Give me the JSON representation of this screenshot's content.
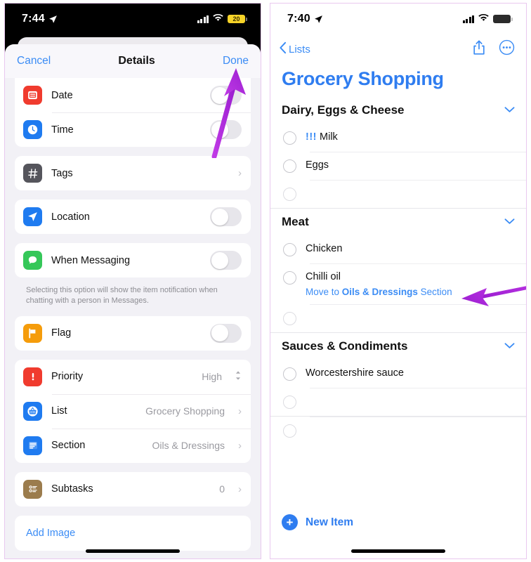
{
  "left_phone": {
    "status": {
      "time": "7:44",
      "location_icon": "location-arrow-icon",
      "signal": "cellular-bars-icon",
      "wifi": "wifi-icon",
      "battery_level": "20",
      "battery_mode": "low-power"
    },
    "sheet": {
      "cancel_label": "Cancel",
      "title": "Details",
      "done_label": "Done",
      "groups": [
        {
          "rows": [
            {
              "icon": "calendar-icon",
              "icon_color": "#f03b2e",
              "label": "Date",
              "control": "toggle",
              "toggle_on": false
            },
            {
              "icon": "clock-icon",
              "icon_color": "#1f7bf0",
              "label": "Time",
              "control": "toggle",
              "toggle_on": false
            }
          ]
        },
        {
          "rows": [
            {
              "icon": "hash-tag-icon",
              "icon_color": "#55555c",
              "label": "Tags",
              "control": "chevron",
              "chevron": "›"
            }
          ]
        },
        {
          "rows": [
            {
              "icon": "location-icon",
              "icon_color": "#1f7bf0",
              "label": "Location",
              "control": "toggle",
              "toggle_on": false
            }
          ]
        },
        {
          "rows": [
            {
              "icon": "messages-icon",
              "icon_color": "#35c759",
              "label": "When Messaging",
              "control": "toggle",
              "toggle_on": false
            }
          ],
          "footnote": "Selecting this option will show the item notification when chatting with a person in Messages."
        },
        {
          "rows": [
            {
              "icon": "flag-icon",
              "icon_color": "#f59c0b",
              "label": "Flag",
              "control": "toggle",
              "toggle_on": false
            }
          ]
        },
        {
          "rows": [
            {
              "icon": "priority-exclamation-icon",
              "icon_color": "#f03b2e",
              "label": "Priority",
              "value": "High",
              "control": "stepper",
              "stepper": "⌃⌄"
            },
            {
              "icon": "basket-icon",
              "icon_color": "#1f7bf0",
              "label": "List",
              "value": "Grocery Shopping",
              "control": "chevron",
              "chevron": "›"
            },
            {
              "icon": "section-lines-icon",
              "icon_color": "#1f7bf0",
              "label": "Section",
              "value": "Oils & Dressings",
              "control": "chevron",
              "chevron": "›"
            }
          ]
        },
        {
          "rows": [
            {
              "icon": "subtasks-icon",
              "icon_color": "#9b7c4d",
              "label": "Subtasks",
              "value": "0",
              "control": "chevron",
              "chevron": "›"
            }
          ]
        }
      ],
      "add_image_label": "Add Image"
    }
  },
  "right_phone": {
    "status": {
      "time": "7:40",
      "location_icon": "location-arrow-icon",
      "signal": "cellular-bars-icon",
      "wifi": "wifi-icon",
      "battery_level": "",
      "battery_mode": "normal"
    },
    "nav": {
      "back_label": "Lists",
      "back_icon": "chevron-left-icon",
      "share_icon": "share-icon",
      "more_icon": "more-circle-icon"
    },
    "title": "Grocery Shopping",
    "sections": [
      {
        "name": "Dairy, Eggs & Cheese",
        "collapse_icon": "chevron-down-icon",
        "items": [
          {
            "priority_marks": "!!!",
            "text": "Milk"
          },
          {
            "priority_marks": "",
            "text": "Eggs"
          },
          {
            "priority_marks": "",
            "text": "",
            "placeholder": true
          }
        ]
      },
      {
        "name": "Meat",
        "collapse_icon": "chevron-down-icon",
        "items": [
          {
            "priority_marks": "",
            "text": "Chicken"
          },
          {
            "priority_marks": "",
            "text": "Chilli oil",
            "hint_prefix": "Move to ",
            "hint_bold": "Oils & Dressings",
            "hint_suffix": " Section"
          },
          {
            "priority_marks": "",
            "text": "",
            "placeholder": true
          }
        ]
      },
      {
        "name": "Sauces & Condiments",
        "collapse_icon": "chevron-down-icon",
        "items": [
          {
            "priority_marks": "",
            "text": "Worcestershire sauce"
          },
          {
            "priority_marks": "",
            "text": "",
            "placeholder": true
          },
          {
            "priority_marks": "",
            "text": "",
            "placeholder": true
          }
        ]
      }
    ],
    "new_item_label": "New Item",
    "new_item_icon": "plus-circle-icon"
  },
  "annotations": {
    "arrow_color": "#a32ad6",
    "arrow_done": "arrow-pointing-to-done-button",
    "arrow_move": "arrow-pointing-to-move-to-section-hint"
  }
}
